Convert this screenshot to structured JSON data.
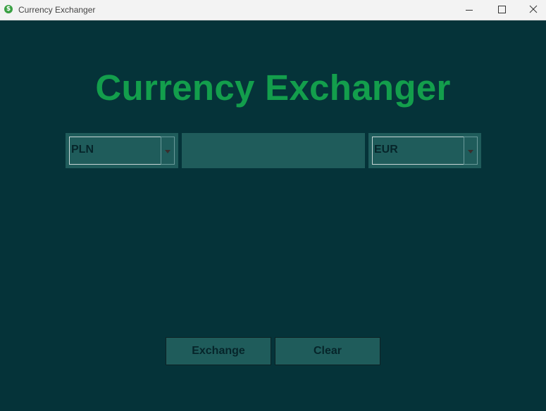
{
  "window": {
    "title": "Currency Exchanger",
    "icon": "dollar-icon",
    "controls": [
      "minimize-icon",
      "maximize-icon",
      "close-icon"
    ]
  },
  "main": {
    "heading": "Currency Exchanger",
    "from_currency": {
      "selected": "PLN"
    },
    "amount_input": {
      "value": "",
      "placeholder": ""
    },
    "to_currency": {
      "selected": "EUR"
    },
    "buttons": {
      "exchange": "Exchange",
      "clear": "Clear"
    }
  },
  "colors": {
    "background": "#053339",
    "panel": "#1f5c5b",
    "heading": "#139e4c",
    "text": "#06252a"
  }
}
